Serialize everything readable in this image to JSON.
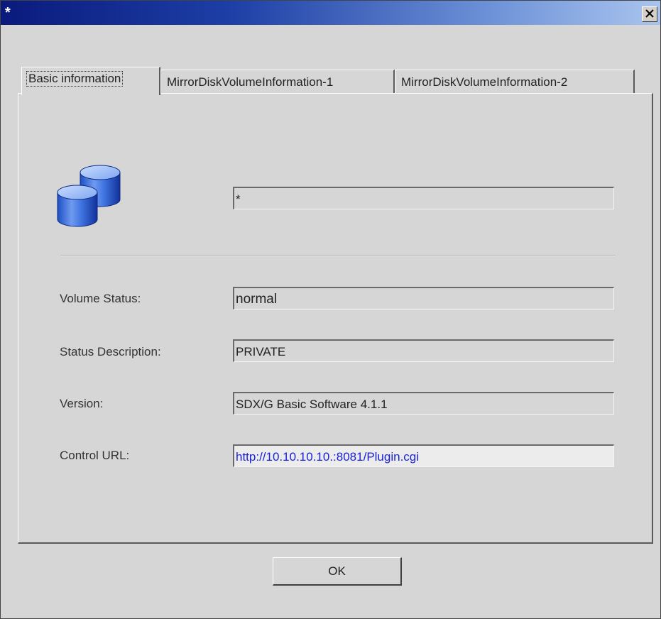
{
  "window": {
    "title": "*",
    "close_label": "×"
  },
  "tabs": [
    {
      "label": "Basic information",
      "active": true
    },
    {
      "label": "MirrorDiskVolumeInformation-1",
      "active": false
    },
    {
      "label": "MirrorDiskVolumeInformation-2",
      "active": false
    }
  ],
  "header": {
    "icon": "disk-volume-icon",
    "name_value": "*"
  },
  "fields": {
    "volume_status": {
      "label": "Volume Status:",
      "value": "normal"
    },
    "status_description": {
      "label": "Status Description:",
      "value": "PRIVATE"
    },
    "version": {
      "label": "Version:",
      "value": "SDX/G Basic Software 4.1.1"
    },
    "control_url": {
      "label": "Control URL:",
      "value": "http://10.10.10.10.:8081/Plugin.cgi"
    }
  },
  "buttons": {
    "ok_label": "OK"
  },
  "colors": {
    "title_bar_start": "#0a1a7c",
    "title_bar_end": "#a9c4ee",
    "link": "#1a22d8",
    "dialog_bg": "#d6d6d6"
  }
}
